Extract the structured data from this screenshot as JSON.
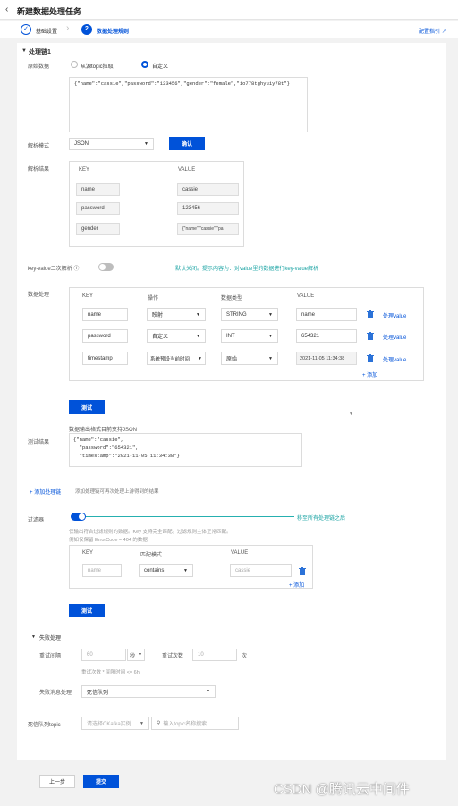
{
  "header": {
    "title": "新建数据处理任务"
  },
  "steps": [
    {
      "label": "基础设置"
    },
    {
      "label": "数据处理规则"
    }
  ],
  "help_link": "配置指引",
  "chain": {
    "title": "处理链1",
    "source_label": "原始数据",
    "source_options": [
      "从源topic拉取",
      "自定义"
    ],
    "raw_json": "{\"name\":\"cassie\",\"password\":\"123456\",\"gender\":\"female\",\"io778tghyuiy78t\"}",
    "parse_mode_label": "解析模式",
    "parse_mode": "JSON",
    "confirm_label": "确认",
    "parse_result_label": "解析结果",
    "result_headers": [
      "KEY",
      "VALUE"
    ],
    "result_rows": [
      {
        "key": "name",
        "value": "cassie"
      },
      {
        "key": "password",
        "value": "123456"
      },
      {
        "key": "gender",
        "value": "{\"name\":\"cassie\",\"pa"
      }
    ],
    "kv_label": "key-value二次解析",
    "kv_note": "默认关闭。提示内容为：对value里的数据进行key-value解析",
    "process_label": "数据处理",
    "process_headers": [
      "KEY",
      "操作",
      "数据类型",
      "VALUE"
    ],
    "process_rows": [
      {
        "key": "name",
        "op": "映射",
        "type": "STRING",
        "value": "name",
        "action": "处理value"
      },
      {
        "key": "password",
        "op": "自定义",
        "type": "INT",
        "value": "654321",
        "action": "处理value"
      },
      {
        "key": "timestamp",
        "op": "系统预设当前时间",
        "type": "原始",
        "value": "2021-11-05 11:34:38",
        "action": "处理value"
      }
    ],
    "add_label": "+ 添加",
    "test_label": "测试",
    "output_note": "数据输出格式目前支持JSON",
    "test_result_label": "测试结果",
    "test_result_lines": [
      "{\"name\":\"cassie\",",
      "  \"password\":\"654321\",",
      "  \"timestamp\":\"2021-11-05 11:34:38\"}"
    ]
  },
  "add_chain": {
    "label": "添加处理链",
    "note": "添加处理链可再次处理上游得到的结果"
  },
  "filter": {
    "label": "过滤器",
    "note": "移至所有处理链之后",
    "hint_lines": [
      "仅输出符合过滤规则的数据。Key 支持完全匹配。过滤规则主体正常匹配。",
      "例如仅保留 ErrorCode = 404 的数据"
    ],
    "headers": [
      "KEY",
      "匹配模式",
      "VALUE"
    ],
    "row": {
      "key_ph": "name",
      "mode": "contains",
      "value_ph": "cassie"
    },
    "add_label": "+ 添加",
    "test_label": "测试"
  },
  "failure": {
    "title": "失败处理",
    "retry_interval_label": "重试间隔",
    "retry_interval": "60",
    "retry_unit": "秒",
    "retry_count_label": "重试次数",
    "retry_count": "10",
    "retry_count_unit": "次",
    "retry_hint": "重试次数 * 间隔时间 <= 6h",
    "fail_handle_label": "失败消息处理",
    "fail_handle": "死信队列",
    "dlq_label": "死信队列topic",
    "dlq_instance_ph": "请选择CKafka实例",
    "dlq_topic_ph": "输入topic名称搜索"
  },
  "footer": {
    "prev_label": "上一步",
    "submit_label": "提交"
  },
  "watermark": "CSDN @腾讯云中间件"
}
